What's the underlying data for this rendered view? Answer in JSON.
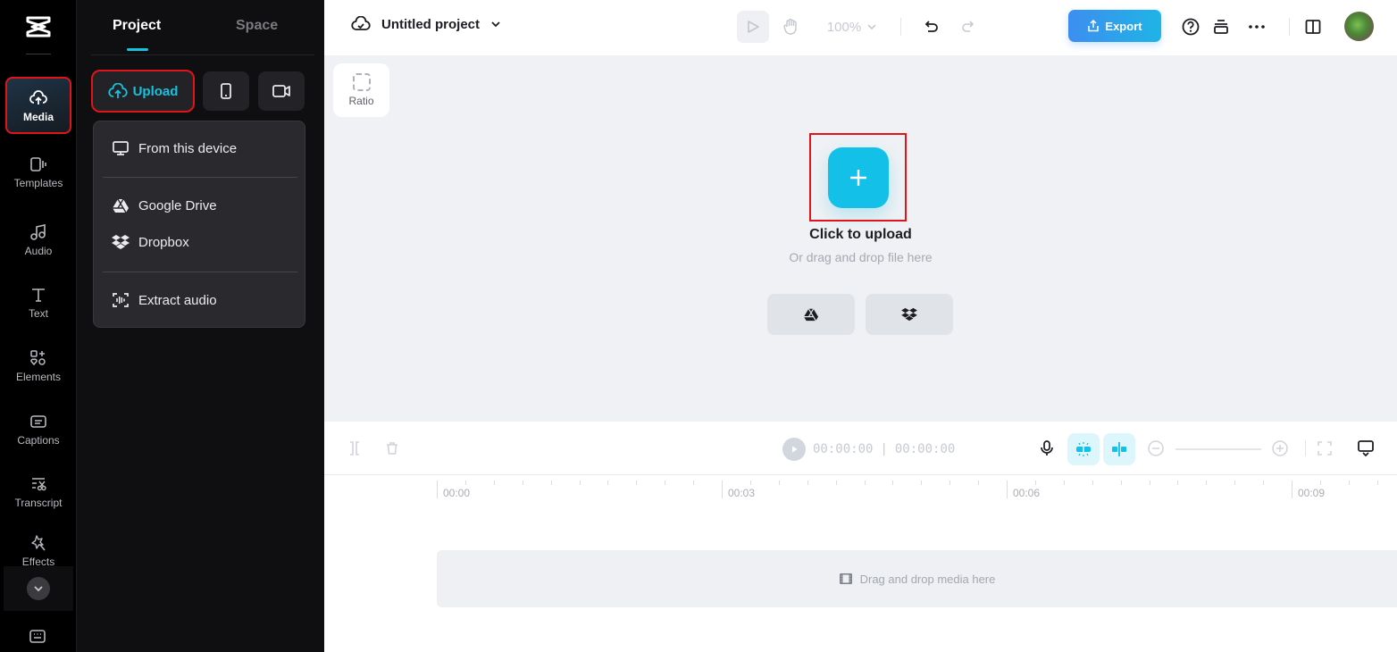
{
  "rail": {
    "logo": "capcut-logo",
    "items": [
      {
        "id": "media",
        "label": "Media",
        "active": true
      },
      {
        "id": "templates",
        "label": "Templates"
      },
      {
        "id": "audio",
        "label": "Audio"
      },
      {
        "id": "text",
        "label": "Text"
      },
      {
        "id": "elements",
        "label": "Elements"
      },
      {
        "id": "captions",
        "label": "Captions"
      },
      {
        "id": "transcript",
        "label": "Transcript"
      },
      {
        "id": "effects",
        "label": "Effects"
      }
    ]
  },
  "panel": {
    "tabs": [
      {
        "label": "Project",
        "active": true
      },
      {
        "label": "Space",
        "active": false
      }
    ],
    "upload_label": "Upload",
    "dropdown": {
      "items": [
        {
          "label": "From this device",
          "icon": "monitor-icon"
        },
        {
          "label": "Google Drive",
          "icon": "google-drive-icon"
        },
        {
          "label": "Dropbox",
          "icon": "dropbox-icon"
        },
        {
          "label": "Extract audio",
          "icon": "extract-audio-icon"
        }
      ]
    }
  },
  "topbar": {
    "project_title": "Untitled project",
    "zoom_level": "100%",
    "export_label": "Export"
  },
  "canvas": {
    "ratio_label": "Ratio",
    "upload_title": "Click to upload",
    "upload_subtitle": "Or drag and drop file here"
  },
  "timeline": {
    "current_time": "00:00:00",
    "separator": "|",
    "total_time": "00:00:00",
    "ruler_labels": [
      "00:00",
      "00:03",
      "00:06",
      "00:09"
    ],
    "drop_hint": "Drag and drop media here"
  },
  "colors": {
    "accent": "#16c2de",
    "highlight": "#e0141b",
    "export_gradient_start": "#3d8ef0",
    "export_gradient_end": "#1fb4e6"
  }
}
